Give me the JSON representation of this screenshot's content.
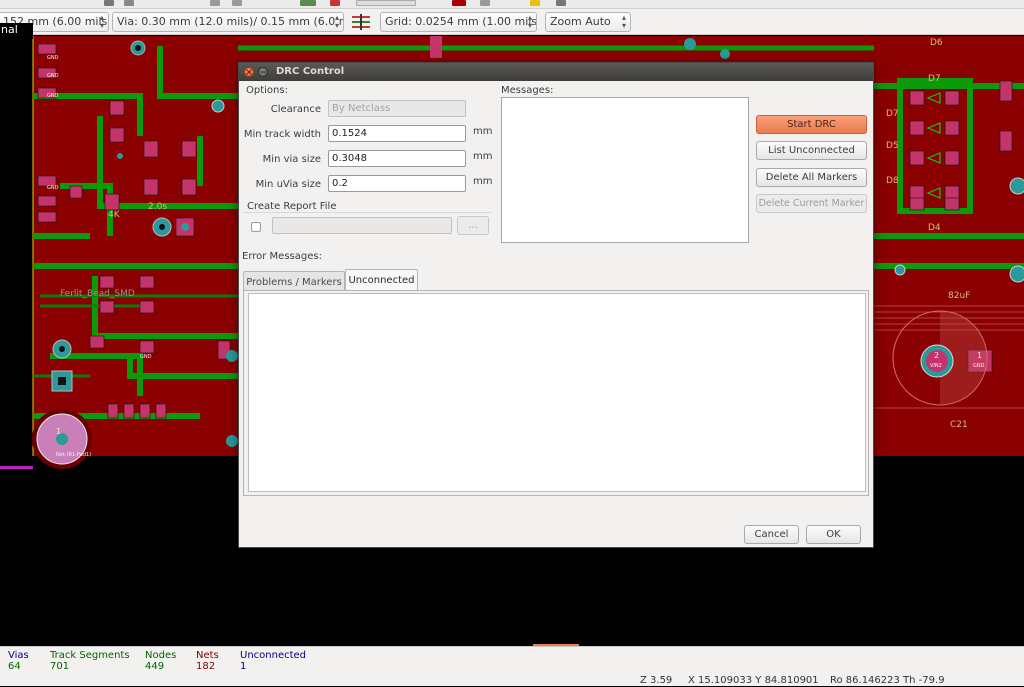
{
  "toolbar": {
    "track_width": "152 mm (6.00 mils)",
    "via_size": "Via: 0.30 mm (12.0 mils)/ 0.15 mm (6.0 mils)",
    "grid": "Grid: 0.0254 mm (1.00 mils)",
    "zoom": "Zoom Auto"
  },
  "side_panel_label": "nal",
  "board_silkscreen": [
    "GND",
    "GND",
    "GND",
    "GND",
    "GND",
    "D6",
    "D7",
    "D7",
    "D5",
    "D8",
    "D4",
    "2.0s",
    "4K",
    "Ferlit_Bead_SMD",
    "Net-(R1-Pad1)",
    "VIN2",
    "GND",
    "1",
    "2",
    "1",
    "C21",
    "82uF"
  ],
  "dialog": {
    "title": "DRC Control",
    "options_heading": "Options:",
    "clearance_label": "Clearance",
    "clearance_value": "By Netclass",
    "min_track_label": "Min track width",
    "min_track_value": "0.1524",
    "min_via_label": "Min via size",
    "min_via_value": "0.3048",
    "min_uvia_label": "Min uVia size",
    "min_uvia_value": "0.2",
    "unit": "mm",
    "report_heading": "Create Report File",
    "browse_label": "...",
    "messages_heading": "Messages:",
    "start_drc": "Start DRC",
    "list_unconnected": "List Unconnected",
    "delete_all": "Delete All Markers",
    "delete_current": "Delete Current Marker",
    "error_heading": "Error Messages:",
    "tabs": [
      "Problems / Markers",
      "Unconnected"
    ],
    "active_tab": "Unconnected",
    "cancel": "Cancel",
    "ok": "OK"
  },
  "status": {
    "vias_label": "Vias",
    "vias_value": "64",
    "tracks_label": "Track Segments",
    "tracks_value": "701",
    "nodes_label": "Nodes",
    "nodes_value": "449",
    "nets_label": "Nets",
    "nets_value": "182",
    "unconnected_label": "Unconnected",
    "unconnected_value": "1",
    "zoom_readout": "Z 3.59",
    "xy_readout": "X 15.109033  Y 84.810901",
    "polar_readout": "Ro 86.146223  Th -79.9"
  },
  "colors": {
    "board_copper": "#8b0000",
    "board_zone": "#009900",
    "pad": "#c4346a",
    "via": "#2a9a9a",
    "start_drc_accent": "#ec7a4f",
    "status_blue": "#000080",
    "status_green": "#006400",
    "status_red": "#800000"
  }
}
